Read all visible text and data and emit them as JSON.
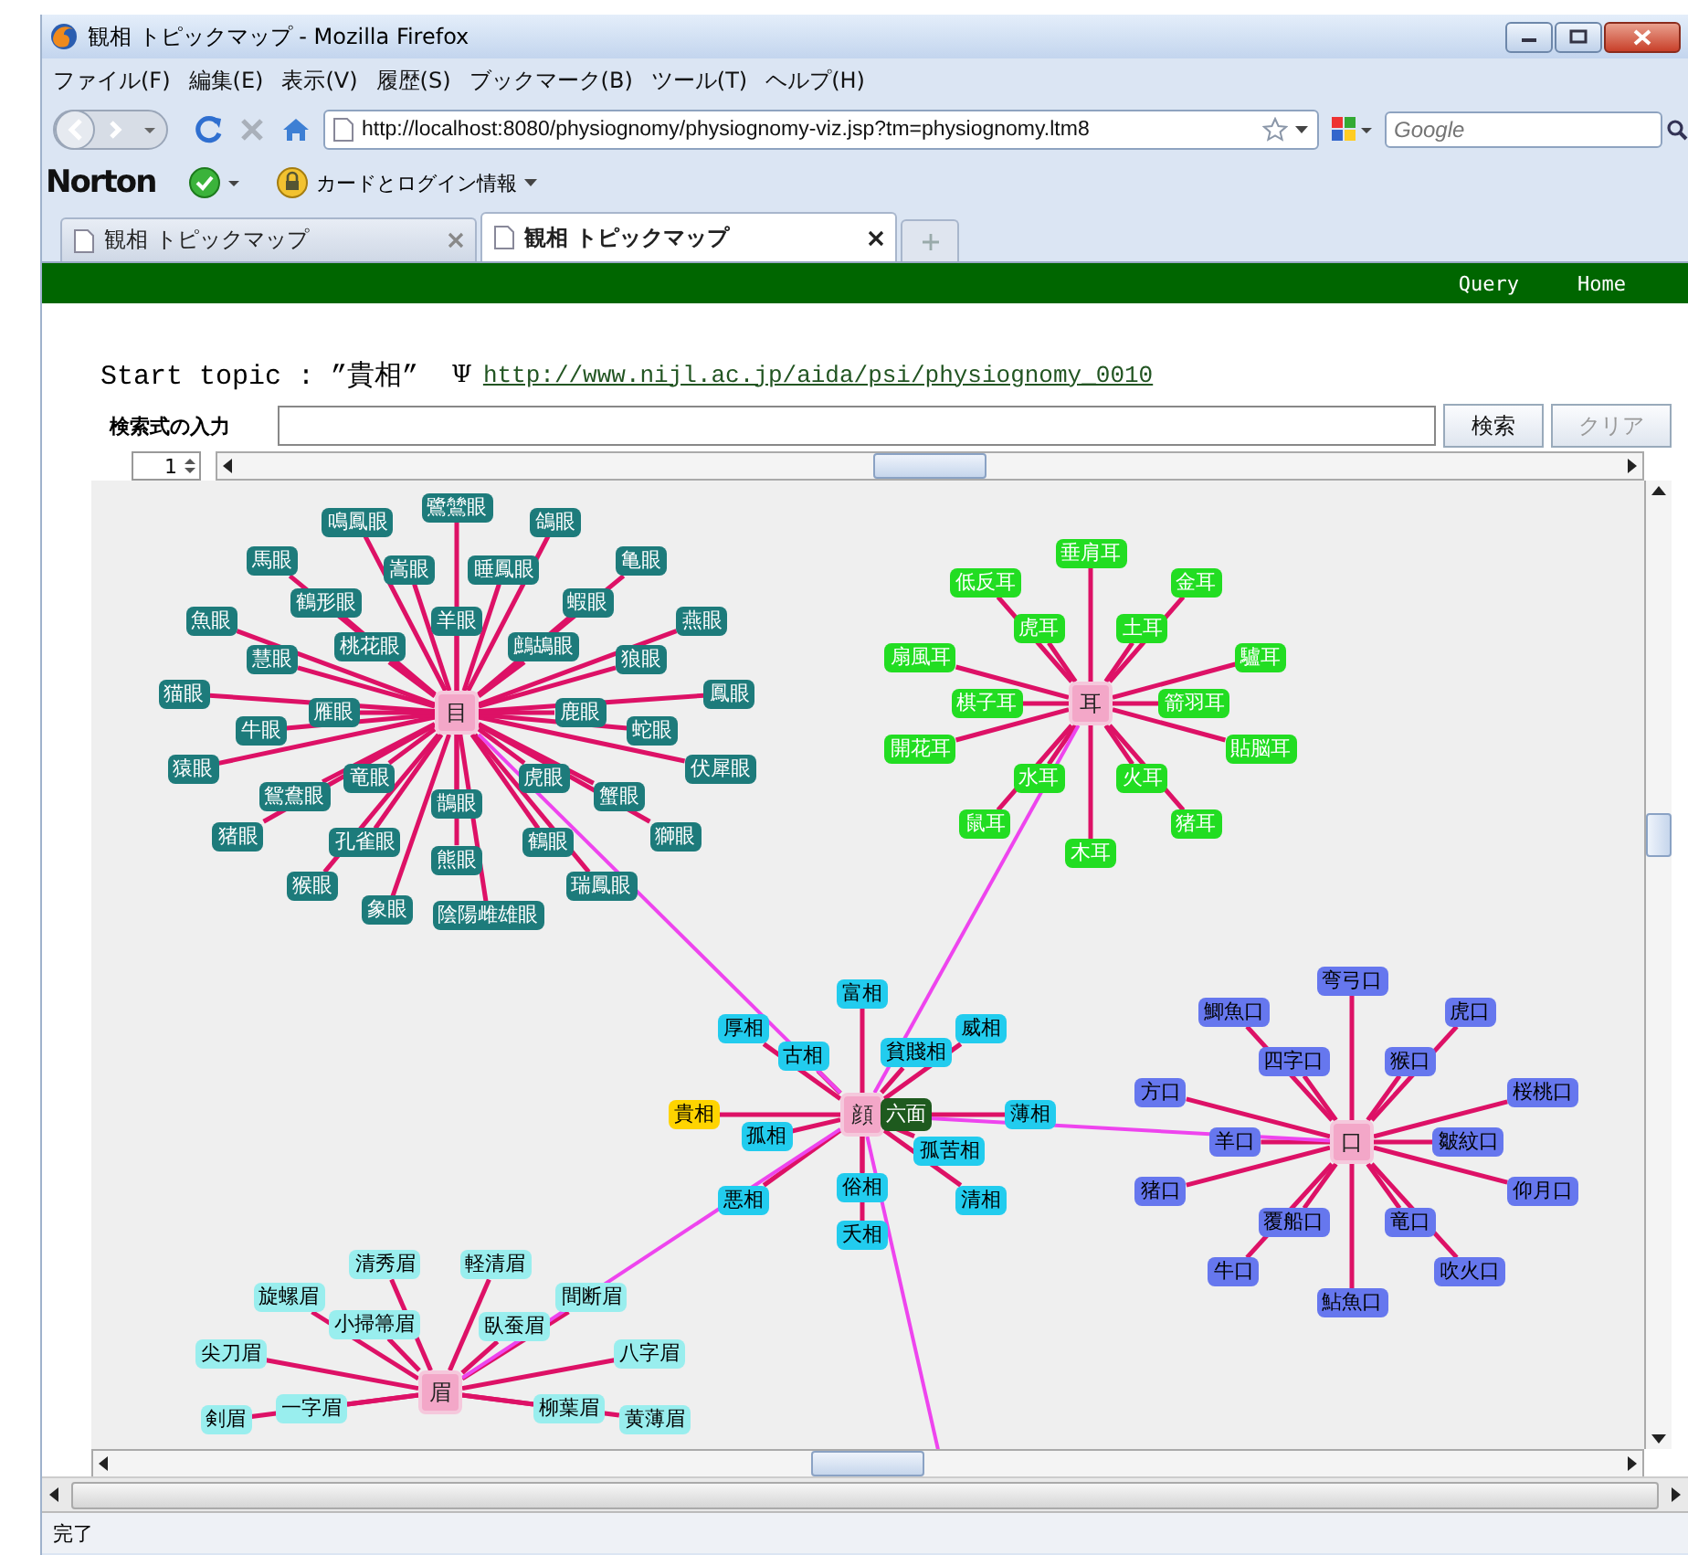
{
  "window": {
    "title": "観相 トピックマップ - Mozilla Firefox"
  },
  "menu": [
    "ファイル(F)",
    "編集(E)",
    "表示(V)",
    "履歴(S)",
    "ブックマーク(B)",
    "ツール(T)",
    "ヘルプ(H)"
  ],
  "navigation": {
    "url": "http://localhost:8080/physiognomy/physiognomy-viz.jsp?tm=physiognomy.ltm8",
    "search_placeholder": "Google"
  },
  "norton_bar": {
    "brand": "Norton",
    "item": "カードとログイン情報"
  },
  "tabs": [
    {
      "label": "観相 トピックマップ",
      "selected": false
    },
    {
      "label": "観相 トピックマップ",
      "selected": true
    }
  ],
  "site_nav": [
    "Query",
    "Home"
  ],
  "start_topic": {
    "label": "Start topic : ”貴相”",
    "psi": "Ψ",
    "link": "http://www.nijl.ac.jp/aida/psi/physiognomy_0010"
  },
  "search": {
    "label": "検索式の入力",
    "buttons": [
      {
        "label": "検索",
        "disabled": false
      },
      {
        "label": "クリア",
        "disabled": true
      }
    ]
  },
  "depth": {
    "value": "1"
  },
  "graph": {
    "clusters": [
      {
        "hub": "目",
        "kind": "satellite",
        "color": "#1d7b7b",
        "light_text": true,
        "nodes": [
          {
            "label": "鷺鷥眼",
            "selected": false
          },
          {
            "label": "鴿眼",
            "selected": false
          },
          {
            "label": "亀眼",
            "selected": false
          },
          {
            "label": "燕眼",
            "selected": false
          },
          {
            "label": "鳳眼",
            "selected": false
          },
          {
            "label": "伏犀眼",
            "selected": false
          },
          {
            "label": "獅眼",
            "selected": false
          },
          {
            "label": "瑞鳳眼",
            "selected": false
          },
          {
            "label": "陰陽雌雄眼",
            "selected": false
          },
          {
            "label": "象眼",
            "selected": false
          },
          {
            "label": "猴眼",
            "selected": false
          },
          {
            "label": "猪眼",
            "selected": false
          },
          {
            "label": "猿眼",
            "selected": false
          },
          {
            "label": "猫眼",
            "selected": false
          },
          {
            "label": "魚眼",
            "selected": false
          },
          {
            "label": "馬眼",
            "selected": false
          },
          {
            "label": "鳴鳳眼",
            "selected": false
          },
          {
            "label": "睡鳳眼",
            "selected": false
          },
          {
            "label": "蝦眼",
            "selected": false
          },
          {
            "label": "狼眼",
            "selected": false
          },
          {
            "label": "蛇眼",
            "selected": false
          },
          {
            "label": "蟹眼",
            "selected": false
          },
          {
            "label": "鶴眼",
            "selected": false
          },
          {
            "label": "熊眼",
            "selected": false
          },
          {
            "label": "孔雀眼",
            "selected": false
          },
          {
            "label": "鴛鴦眼",
            "selected": false
          },
          {
            "label": "牛眼",
            "selected": false
          },
          {
            "label": "慧眼",
            "selected": false
          },
          {
            "label": "鶴形眼",
            "selected": false
          },
          {
            "label": "嵩眼",
            "selected": false
          },
          {
            "label": "鷓鴣眼",
            "selected": false
          },
          {
            "label": "鹿眼",
            "selected": false
          },
          {
            "label": "虎眼",
            "selected": false
          },
          {
            "label": "鵲眼",
            "selected": false
          },
          {
            "label": "竜眼",
            "selected": false
          },
          {
            "label": "雁眼",
            "selected": false
          },
          {
            "label": "桃花眼",
            "selected": false
          },
          {
            "label": "羊眼",
            "selected": false
          }
        ]
      },
      {
        "hub": "耳",
        "kind": "satellite",
        "color": "#22dd22",
        "light_text": true,
        "nodes": [
          {
            "label": "垂肩耳",
            "selected": false
          },
          {
            "label": "金耳",
            "selected": false
          },
          {
            "label": "驢耳",
            "selected": false
          },
          {
            "label": "貼脳耳",
            "selected": false
          },
          {
            "label": "猪耳",
            "selected": false
          },
          {
            "label": "木耳",
            "selected": false
          },
          {
            "label": "鼠耳",
            "selected": false
          },
          {
            "label": "開花耳",
            "selected": false
          },
          {
            "label": "扇風耳",
            "selected": false
          },
          {
            "label": "低反耳",
            "selected": false
          },
          {
            "label": "土耳",
            "selected": false
          },
          {
            "label": "箭羽耳",
            "selected": false
          },
          {
            "label": "火耳",
            "selected": false
          },
          {
            "label": "水耳",
            "selected": false
          },
          {
            "label": "棋子耳",
            "selected": false
          },
          {
            "label": "虎耳",
            "selected": false
          }
        ]
      },
      {
        "hub": "顔",
        "kind": "center",
        "badge": "六面",
        "color": "#22ccee",
        "light_text": false,
        "offscreen_edge": true,
        "nodes": [
          {
            "label": "富相",
            "selected": false
          },
          {
            "label": "威相",
            "selected": false
          },
          {
            "label": "薄相",
            "selected": false
          },
          {
            "label": "清相",
            "selected": false
          },
          {
            "label": "夭相",
            "selected": false
          },
          {
            "label": "悪相",
            "selected": false
          },
          {
            "label": "貴相",
            "selected": true
          },
          {
            "label": "厚相",
            "selected": false
          },
          {
            "label": "貧賤相",
            "selected": false
          },
          {
            "label": "孤苦相",
            "selected": false
          },
          {
            "label": "俗相",
            "selected": false
          },
          {
            "label": "孤相",
            "selected": false
          },
          {
            "label": "古相",
            "selected": false
          }
        ]
      },
      {
        "hub": "口",
        "kind": "satellite",
        "color": "#6677ee",
        "light_text": false,
        "nodes": [
          {
            "label": "弯弓口",
            "selected": false
          },
          {
            "label": "虎口",
            "selected": false
          },
          {
            "label": "桜桃口",
            "selected": false
          },
          {
            "label": "仰月口",
            "selected": false
          },
          {
            "label": "吹火口",
            "selected": false
          },
          {
            "label": "鮎魚口",
            "selected": false
          },
          {
            "label": "牛口",
            "selected": false
          },
          {
            "label": "猪口",
            "selected": false
          },
          {
            "label": "方口",
            "selected": false
          },
          {
            "label": "鯽魚口",
            "selected": false
          },
          {
            "label": "猴口",
            "selected": false
          },
          {
            "label": "皺紋口",
            "selected": false
          },
          {
            "label": "竜口",
            "selected": false
          },
          {
            "label": "覆船口",
            "selected": false
          },
          {
            "label": "羊口",
            "selected": false
          },
          {
            "label": "四字口",
            "selected": false
          }
        ]
      },
      {
        "hub": "眉",
        "kind": "satellite",
        "color": "#99eeee",
        "light_text": false,
        "nodes": [
          {
            "label": "剣眉",
            "selected": false
          },
          {
            "label": "尖刀眉",
            "selected": false
          },
          {
            "label": "旋螺眉",
            "selected": false
          },
          {
            "label": "清秀眉",
            "selected": false
          },
          {
            "label": "軽清眉",
            "selected": false
          },
          {
            "label": "間断眉",
            "selected": false
          },
          {
            "label": "八字眉",
            "selected": false
          },
          {
            "label": "黄薄眉",
            "selected": false
          },
          {
            "label": "一字眉",
            "selected": false
          },
          {
            "label": "小掃箒眉",
            "selected": false
          },
          {
            "label": "臥蚕眉",
            "selected": false
          },
          {
            "label": "柳葉眉",
            "selected": false
          }
        ]
      }
    ]
  },
  "status_bar": {
    "text": "完了"
  }
}
